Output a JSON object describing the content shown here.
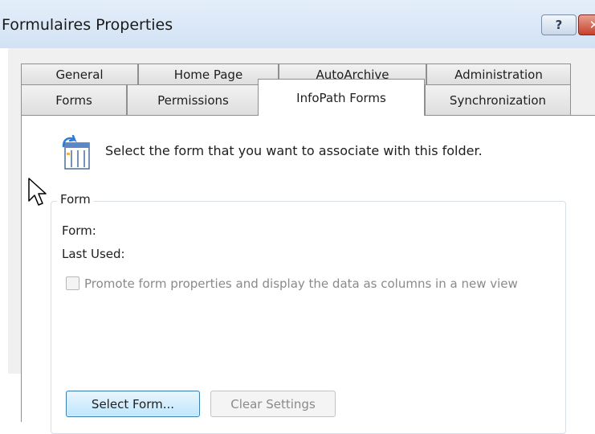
{
  "window": {
    "title": "Formulaires Properties",
    "help_label": "?",
    "close_label": "✕"
  },
  "tabs_row1": [
    "General",
    "Home Page",
    "AutoArchive",
    "Administration"
  ],
  "tabs_row2": [
    "Forms",
    "Permissions",
    "InfoPath Forms",
    "Synchronization"
  ],
  "active_tab": "InfoPath Forms",
  "panel": {
    "instruction": "Select the form that you want to associate with this folder.",
    "icon": "form-document-icon",
    "group": {
      "label": "Form",
      "form_label": "Form:",
      "last_used_label": "Last Used:",
      "checkbox_label": "Promote form properties and display the data as columns in a new view",
      "checkbox_checked": false,
      "checkbox_enabled": false
    },
    "buttons": {
      "select_form": "Select Form...",
      "clear_settings": "Clear Settings"
    }
  },
  "colors": {
    "title_bar": "#d8e6f6",
    "dialog_bg": "#f0f0f0",
    "close_button": "#c8402c",
    "default_button_border": "#3c7fb1"
  }
}
